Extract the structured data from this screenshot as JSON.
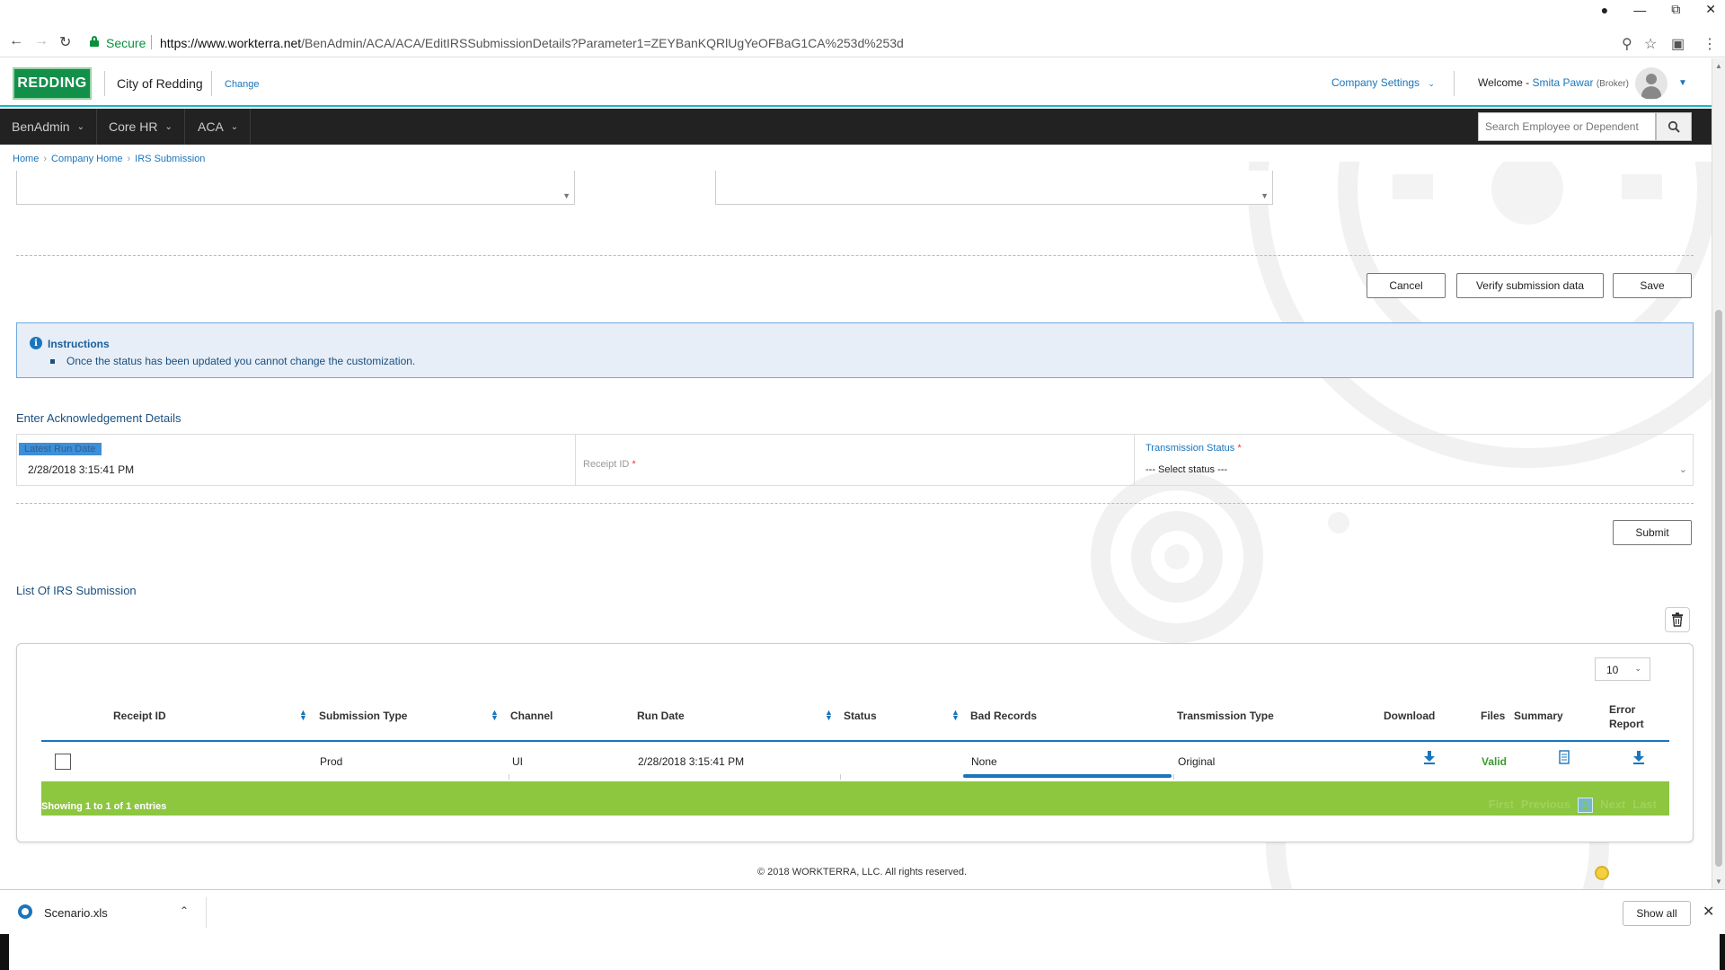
{
  "browser": {
    "secure_label": "Secure",
    "url_host": "https://www.workterra.net",
    "url_path": "/BenAdmin/ACA/ACA/EditIRSSubmissionDetails?Parameter1=ZEYBanKQRlUgYeOFBaG1CA%253d%253d"
  },
  "header": {
    "logo_text": "REDDING",
    "company_name": "City of Redding",
    "change_label": "Change",
    "company_settings_label": "Company Settings",
    "welcome_prefix": "Welcome -",
    "user_name": "Smita Pawar",
    "user_role": "(Broker)"
  },
  "nav": {
    "items": [
      {
        "label": "BenAdmin"
      },
      {
        "label": "Core HR"
      },
      {
        "label": "ACA"
      }
    ],
    "search_placeholder": "Search Employee or Dependent"
  },
  "breadcrumb": {
    "items": [
      "Home",
      "Company Home",
      "IRS Submission"
    ]
  },
  "actions": {
    "cancel_label": "Cancel",
    "verify_label": "Verify submission data",
    "save_label": "Save",
    "submit_label": "Submit"
  },
  "instructions": {
    "title": "Instructions",
    "items": [
      "Once the status has been updated you cannot change the customization."
    ]
  },
  "ack": {
    "section_title": "Enter Acknowledgement Details",
    "latest_run_label": "Latest Run Date",
    "latest_run_value": "2/28/2018 3:15:41 PM",
    "receipt_label": "Receipt ID",
    "transmission_label": "Transmission Status",
    "transmission_placeholder": "--- Select status ---",
    "required_mark": "*"
  },
  "table": {
    "section_title": "List Of IRS Submission",
    "page_size": "10",
    "columns": {
      "receipt_id": "Receipt ID",
      "submission_type": "Submission Type",
      "channel": "Channel",
      "run_date": "Run Date",
      "status": "Status",
      "bad_records": "Bad Records",
      "transmission_type": "Transmission Type",
      "download": "Download",
      "files": "Files",
      "summary": "Summary",
      "error_report_1": "Error",
      "error_report_2": "Report"
    },
    "rows": [
      {
        "receipt_id": "",
        "submission_type": "Prod",
        "channel": "UI",
        "run_date": "2/28/2018 3:15:41 PM",
        "status": "",
        "bad_records": "None",
        "transmission_type": "Original",
        "files": "Valid"
      }
    ],
    "showing_text": "Showing 1 to 1 of 1 entries",
    "pager": {
      "first": "First",
      "previous": "Previous",
      "current": "1",
      "next": "Next",
      "last": "Last"
    }
  },
  "footer": {
    "copyright": "© 2018 WORKTERRA, LLC. All rights reserved."
  },
  "downloads": {
    "file_name": "Scenario.xls",
    "show_all_label": "Show all"
  },
  "colors": {
    "accent": "#1a75bb",
    "nav_bg": "#222222",
    "table_footer": "#8dc63f",
    "valid": "#3a9b2f"
  }
}
